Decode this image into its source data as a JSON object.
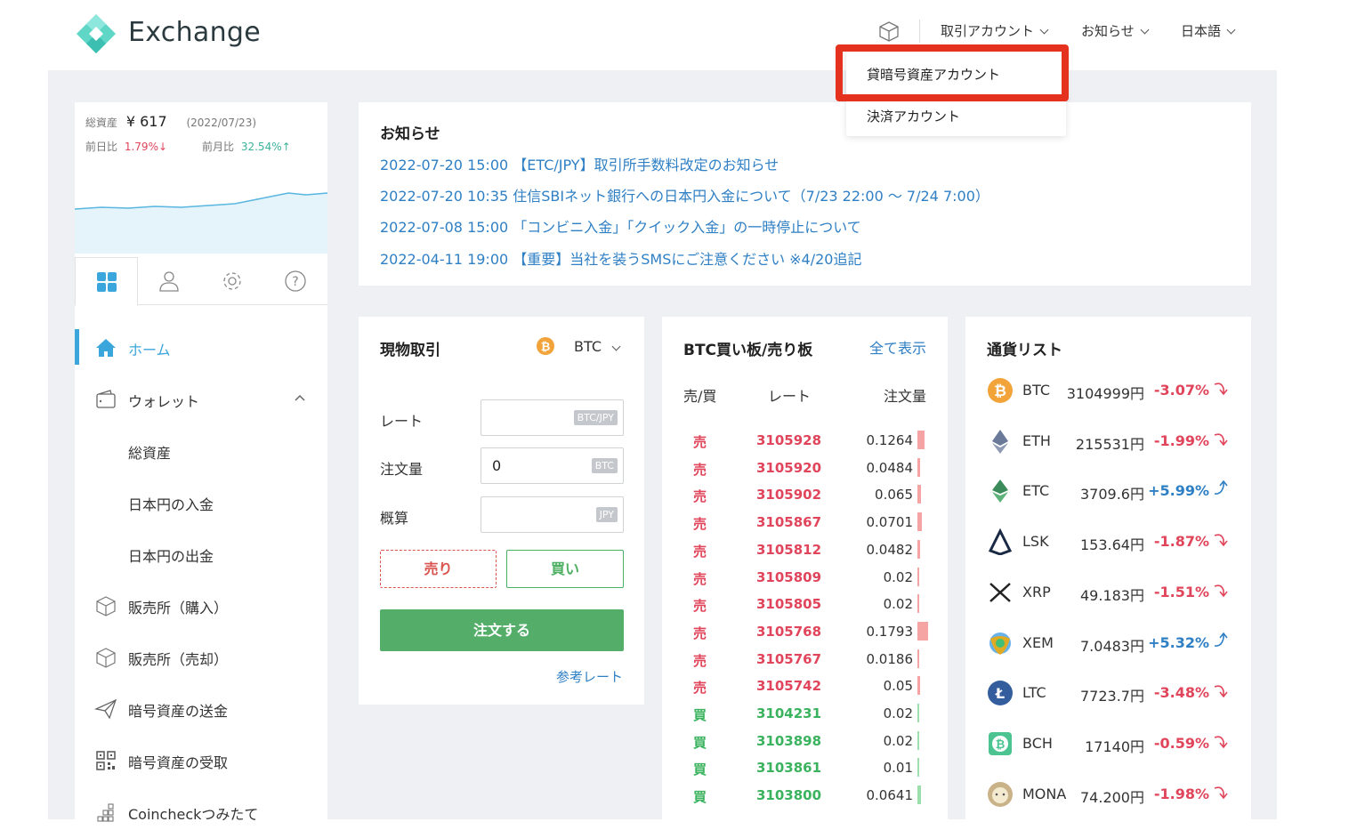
{
  "header": {
    "logo_text": "Exchange",
    "menu_account": "取引アカウント",
    "menu_news": "お知らせ",
    "menu_lang": "日本語"
  },
  "dropdown": {
    "item1": "貸暗号資産アカウント",
    "item2": "決済アカウント"
  },
  "sidebar": {
    "total_label": "総資産",
    "total_value": "¥ 617",
    "total_date": "(2022/07/23)",
    "day_label": "前日比",
    "day_value": "1.79%↓",
    "month_label": "前月比",
    "month_value": "32.54%↑",
    "nav": [
      {
        "label": "ホーム",
        "icon": "home-icon"
      },
      {
        "label": "ウォレット",
        "icon": "wallet-icon"
      },
      {
        "label": "総資産"
      },
      {
        "label": "日本円の入金"
      },
      {
        "label": "日本円の出金"
      },
      {
        "label": "販売所（購入）",
        "icon": "cube-icon"
      },
      {
        "label": "販売所（売却）",
        "icon": "cube-icon"
      },
      {
        "label": "暗号資産の送金",
        "icon": "paper-plane-icon"
      },
      {
        "label": "暗号資産の受取",
        "icon": "qr-code-icon"
      },
      {
        "label": "Coincheckつみたて",
        "icon": "grid-dots-icon"
      }
    ],
    "colors": {
      "up": "#3bb39b",
      "down": "#e0455b",
      "accent": "#3ba6dc"
    }
  },
  "news": {
    "title": "お知らせ",
    "items": [
      "2022-07-20 15:00 【ETC/JPY】取引所手数料改定のお知らせ",
      "2022-07-20 10:35 住信SBIネット銀行への日本円入金について（7/23 22:00 〜 7/24 7:00）",
      "2022-07-08 15:00 「コンビニ入金」「クイック入金」の一時停止について",
      "2022-04-11 19:00 【重要】当社を装うSMSにご注意ください ※4/20追記"
    ]
  },
  "spot": {
    "title": "現物取引",
    "coin": "BTC",
    "rate_label": "レート",
    "rate_unit": "BTC/JPY",
    "qty_label": "注文量",
    "qty_value": "0",
    "qty_unit": "BTC",
    "est_label": "概算",
    "est_unit": "JPY",
    "sell": "売り",
    "buy": "買い",
    "order": "注文する",
    "ref_rate": "参考レート"
  },
  "orderbook": {
    "title": "BTC買い板/売り板",
    "show_all": "全て表示",
    "col_side": "売/買",
    "col_rate": "レート",
    "col_qty": "注文量",
    "rows": [
      {
        "side": "売",
        "price": "3105928",
        "qty": "0.1264",
        "vol": 0.1264
      },
      {
        "side": "売",
        "price": "3105920",
        "qty": "0.0484",
        "vol": 0.0484
      },
      {
        "side": "売",
        "price": "3105902",
        "qty": "0.065",
        "vol": 0.065
      },
      {
        "side": "売",
        "price": "3105867",
        "qty": "0.0701",
        "vol": 0.0701
      },
      {
        "side": "売",
        "price": "3105812",
        "qty": "0.0482",
        "vol": 0.0482
      },
      {
        "side": "売",
        "price": "3105809",
        "qty": "0.02",
        "vol": 0.02
      },
      {
        "side": "売",
        "price": "3105805",
        "qty": "0.02",
        "vol": 0.02
      },
      {
        "side": "売",
        "price": "3105768",
        "qty": "0.1793",
        "vol": 0.1793
      },
      {
        "side": "売",
        "price": "3105767",
        "qty": "0.0186",
        "vol": 0.0186
      },
      {
        "side": "売",
        "price": "3105742",
        "qty": "0.05",
        "vol": 0.05
      },
      {
        "side": "買",
        "price": "3104231",
        "qty": "0.02",
        "vol": 0.02
      },
      {
        "side": "買",
        "price": "3103898",
        "qty": "0.02",
        "vol": 0.02
      },
      {
        "side": "買",
        "price": "3103861",
        "qty": "0.01",
        "vol": 0.01
      },
      {
        "side": "買",
        "price": "3103800",
        "qty": "0.0641",
        "vol": 0.0641
      }
    ],
    "colors": {
      "sell": "#e0455b",
      "buy": "#3bb35e",
      "sell_bar": "#f5a3a3",
      "buy_bar": "#9be0ab"
    }
  },
  "currencies": {
    "title": "通貨リスト",
    "items": [
      {
        "sym": "BTC",
        "price": "3104999円",
        "change": "-3.07%",
        "dir": "down",
        "icon": "bitcoin-icon"
      },
      {
        "sym": "ETH",
        "price": "215531円",
        "change": "-1.99%",
        "dir": "down",
        "icon": "ethereum-icon"
      },
      {
        "sym": "ETC",
        "price": "3709.6円",
        "change": "+5.99%",
        "dir": "up",
        "icon": "ethereum-classic-icon"
      },
      {
        "sym": "LSK",
        "price": "153.64円",
        "change": "-1.87%",
        "dir": "down",
        "icon": "lisk-icon"
      },
      {
        "sym": "XRP",
        "price": "49.183円",
        "change": "-1.51%",
        "dir": "down",
        "icon": "xrp-icon"
      },
      {
        "sym": "XEM",
        "price": "7.0483円",
        "change": "+5.32%",
        "dir": "up",
        "icon": "nem-icon"
      },
      {
        "sym": "LTC",
        "price": "7723.7円",
        "change": "-3.48%",
        "dir": "down",
        "icon": "litecoin-icon"
      },
      {
        "sym": "BCH",
        "price": "17140円",
        "change": "-0.59%",
        "dir": "down",
        "icon": "bitcoin-cash-icon"
      },
      {
        "sym": "MONA",
        "price": "74.200円",
        "change": "-1.98%",
        "dir": "down",
        "icon": "monacoin-icon"
      }
    ],
    "colors": {
      "down": "#e0455b",
      "up": "#2f7fc4"
    }
  }
}
